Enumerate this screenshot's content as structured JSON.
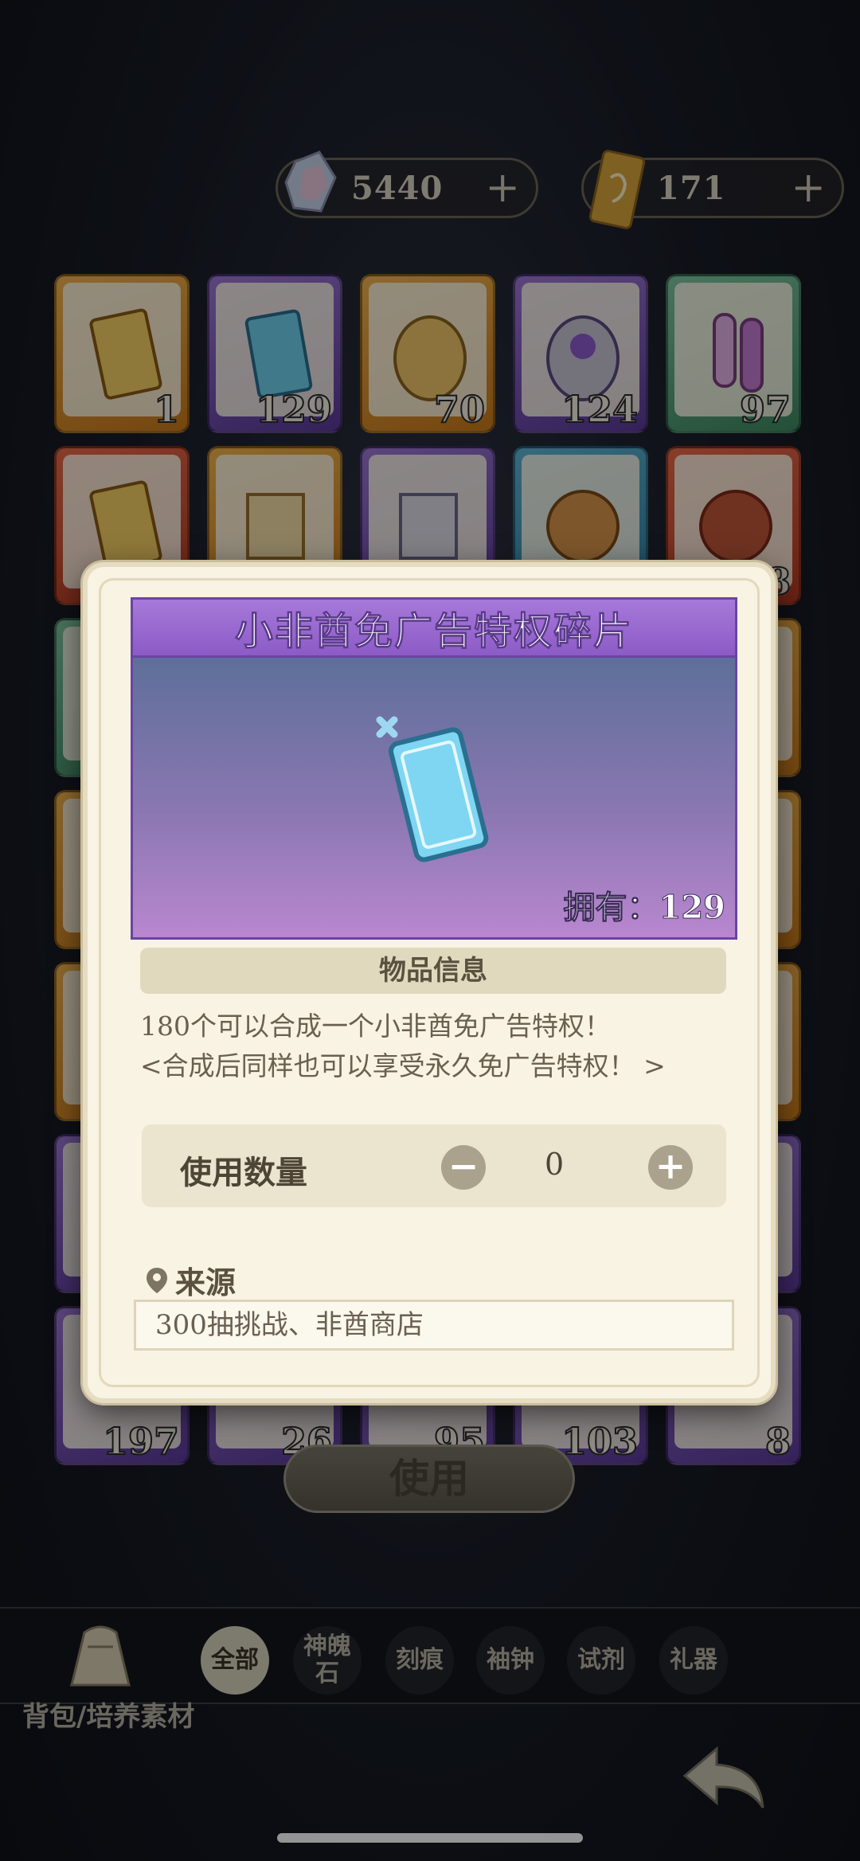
{
  "currencies": [
    {
      "icon": "crystal-icon",
      "value": "5440",
      "add": "+"
    },
    {
      "icon": "ticket-icon",
      "value": "171",
      "add": "+"
    }
  ],
  "grid_counts": [
    "1",
    "129",
    "70",
    "124",
    "97",
    "",
    "",
    "",
    "",
    "8"
  ],
  "modal": {
    "title": "小非酋免广告特权碎片",
    "owned": "拥有：129",
    "info_header": "物品信息",
    "description_line1": "180个可以合成一个小非酋免广告特权！",
    "description_line2": "<合成后同样也可以享受永久免广告特权！ >",
    "quantity_label": "使用数量",
    "quantity_value": "0",
    "minus": "−",
    "plus": "+",
    "source_label": "来源",
    "source_value": "300抽挑战、非酋商店"
  },
  "partial_counts": [
    "197",
    "26",
    "95",
    "103",
    "8"
  ],
  "use_button": "使用",
  "tabs": [
    {
      "label": "全部",
      "active": true
    },
    {
      "label": "神魄石",
      "active": false
    },
    {
      "label": "刻痕",
      "active": false
    },
    {
      "label": "袖钟",
      "active": false
    },
    {
      "label": "试剂",
      "active": false
    },
    {
      "label": "礼器",
      "active": false
    }
  ],
  "breadcrumb": "背包/培养素材",
  "colors": {
    "accent_purple": "#8c5bc6",
    "panel_cream": "#f8f3e3",
    "active_tab": "#d8d2bd"
  }
}
